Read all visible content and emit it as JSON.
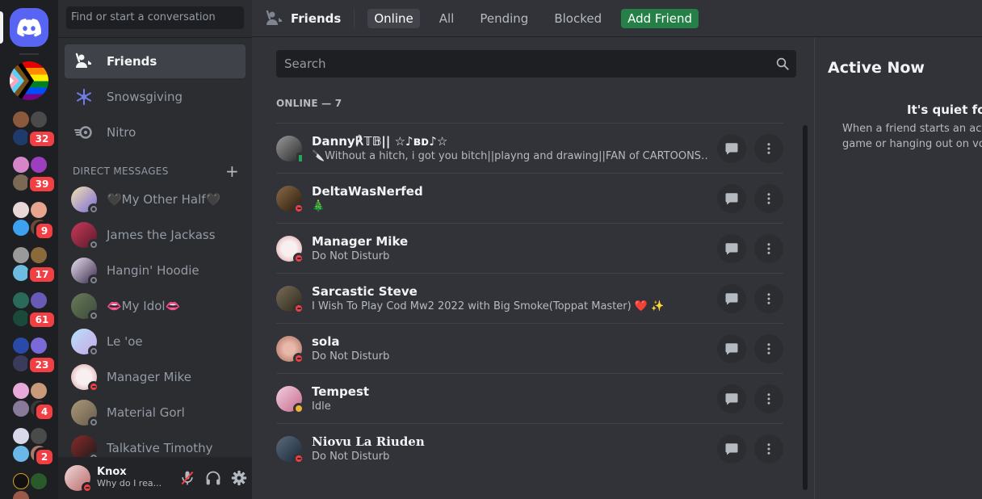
{
  "sidebar": {
    "search_placeholder": "Find or start a conversation",
    "nav": [
      {
        "label": "Friends",
        "icon": "friends-icon",
        "active": true
      },
      {
        "label": "Snowsgiving",
        "icon": "snowflake-icon"
      },
      {
        "label": "Nitro",
        "icon": "nitro-icon"
      }
    ],
    "dm_header": "DIRECT MESSAGES",
    "dm_add": "+",
    "dms": [
      {
        "name": "🖤My Other Half🖤",
        "status": "offline"
      },
      {
        "name": "James the Jackass",
        "status": "offline"
      },
      {
        "name": "Hangin' Hoodie",
        "status": "offline"
      },
      {
        "name": "👄My Idol👄",
        "status": "offline"
      },
      {
        "name": "Le 'oe",
        "status": "offline"
      },
      {
        "name": "Manager Mike",
        "status": "dnd"
      },
      {
        "name": "Material Gorl",
        "status": "offline"
      },
      {
        "name": "Talkative Timothy",
        "status": "offline"
      }
    ]
  },
  "rail": {
    "badges": [
      "32",
      "39",
      "9",
      "17",
      "61",
      "23",
      "4",
      "2"
    ]
  },
  "user_panel": {
    "name": "Knox",
    "subtext": "Why do I rea...",
    "status": "dnd"
  },
  "topbar": {
    "title": "Friends",
    "tabs": [
      "Online",
      "All",
      "Pending",
      "Blocked"
    ],
    "active_tab": "Online",
    "add_friend": "Add Friend"
  },
  "main": {
    "search_placeholder": "Search",
    "online_header": "ONLINE — 7",
    "friends": [
      {
        "name": "Danny℟𝕋𝔹|| ☆♪ʙᴅ♪☆",
        "sub": "🔪Without a hitch, i got you bitch||playng and drawing||FAN of CARTOONS AND ANIME",
        "status": "mobile"
      },
      {
        "name": "DeltaWasNerfed",
        "sub": "🎄",
        "status": "dnd"
      },
      {
        "name": "Manager Mike",
        "sub": "Do Not Disturb",
        "status": "dnd"
      },
      {
        "name": "Sarcastic Steve",
        "sub": "I Wish To Play Cod Mw2 2022 with Big Smoke(Toppat Master) ❤️ ✨",
        "status": "dnd"
      },
      {
        "name": "sola",
        "sub": "Do Not Disturb",
        "status": "dnd"
      },
      {
        "name": "Tempest",
        "sub": "Idle",
        "status": "idle"
      },
      {
        "name": "𝐍𝐢𝐨𝐯𝐮 𝐋𝐚 𝐑𝐢𝐮𝐝𝐞𝐧",
        "sub": "Do Not Disturb",
        "status": "dnd"
      }
    ]
  },
  "active_now": {
    "title": "Active Now",
    "quiet": "It's quiet for now...",
    "desc_line1": "When a friend starts an activity—like playing a",
    "desc_line2": "game or hanging out on voice—we'll show it here!"
  },
  "colors": {
    "blurple": "#5865f2",
    "green": "#248046",
    "dnd": "#f23f43",
    "idle": "#f0b232",
    "online": "#23a55a"
  }
}
